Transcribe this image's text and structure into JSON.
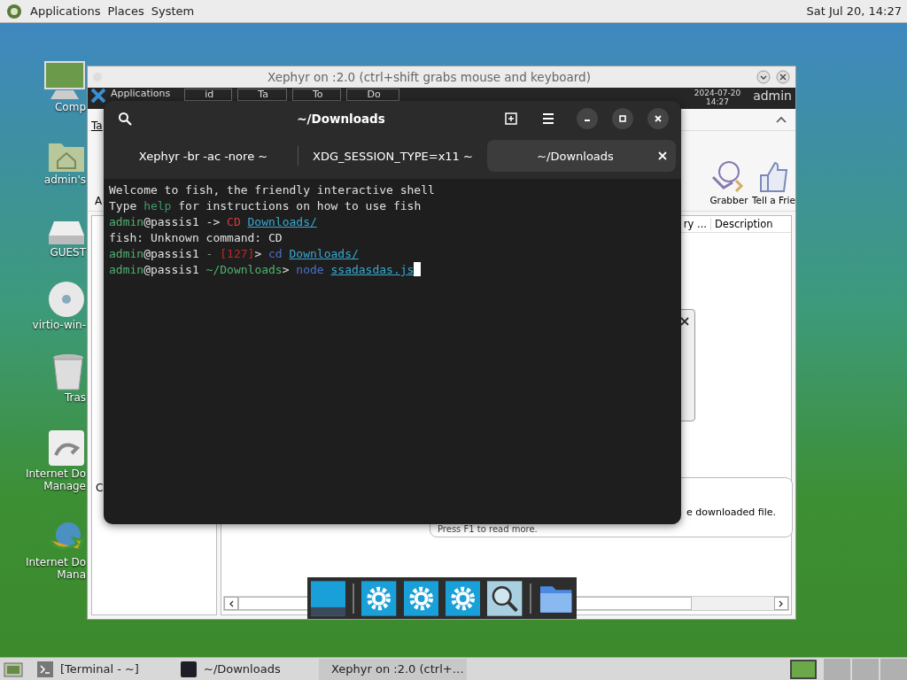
{
  "top_panel": {
    "menus": [
      "Applications",
      "Places",
      "System"
    ],
    "clock": "Sat Jul 20, 14:27"
  },
  "desktop_icons": [
    {
      "kind": "computer",
      "lines": [
        "Comp"
      ]
    },
    {
      "kind": "home",
      "lines": [
        "admin's"
      ]
    },
    {
      "kind": "drive",
      "lines": [
        "GUEST"
      ]
    },
    {
      "kind": "disc",
      "lines": [
        "virtio-win-"
      ]
    },
    {
      "kind": "trash",
      "lines": [
        "Tras"
      ]
    },
    {
      "kind": "installer",
      "lines": [
        "Internet Do",
        "Manage"
      ]
    },
    {
      "kind": "globe",
      "lines": [
        "Internet Do",
        "Mana"
      ]
    }
  ],
  "xephyr": {
    "title": "Xephyr on :2.0 (ctrl+shift grabs mouse and keyboard)",
    "panel": {
      "menu": "Applications",
      "tasks": [
        "id",
        "Ta",
        "To",
        "Do"
      ],
      "date": "2024-07-20",
      "time": "14:27",
      "user": "admin"
    },
    "app": {
      "menu_label": "Ta",
      "side_label": "A",
      "tree_label": "C",
      "toolbar": [
        "Grabber",
        "Tell a Frie"
      ],
      "columns": [
        "ry ...",
        "Description"
      ],
      "notice": [
        "e downloaded file.",
        "Press F1 to read more."
      ]
    }
  },
  "terminal": {
    "title": "~/Downloads",
    "tabs": [
      {
        "label": "Xephyr -br -ac -nore ~",
        "selected": false
      },
      {
        "label": "XDG_SESSION_TYPE=x11 ~",
        "selected": false
      },
      {
        "label": "~/Downloads",
        "selected": true
      }
    ],
    "lines": [
      [
        {
          "t": "Welcome to fish, the friendly interactive shell",
          "kind": "plain"
        }
      ],
      [
        {
          "t": "Type ",
          "kind": "plain"
        },
        {
          "t": "help",
          "kind": "keyword"
        },
        {
          "t": " for instructions on how to use fish",
          "kind": "plain"
        }
      ],
      [
        {
          "t": "admin",
          "kind": "user"
        },
        {
          "t": "@passis1 -> ",
          "kind": "plain"
        },
        {
          "t": "CD ",
          "kind": "bad_command"
        },
        {
          "t": "Downloads/",
          "kind": "path"
        }
      ],
      [
        {
          "t": "fish: Unknown command: CD",
          "kind": "plain"
        }
      ],
      [
        {
          "t": "admin",
          "kind": "user"
        },
        {
          "t": "@passis1 ",
          "kind": "plain"
        },
        {
          "t": "- ",
          "kind": "dim"
        },
        {
          "t": "[127]",
          "kind": "status"
        },
        {
          "t": "> ",
          "kind": "plain"
        },
        {
          "t": "cd ",
          "kind": "command"
        },
        {
          "t": "Downloads/",
          "kind": "path"
        }
      ],
      [
        {
          "t": "admin",
          "kind": "user"
        },
        {
          "t": "@passis1 ",
          "kind": "plain"
        },
        {
          "t": "~/Downloads",
          "kind": "cwd"
        },
        {
          "t": "> ",
          "kind": "plain"
        },
        {
          "t": "node ",
          "kind": "command"
        },
        {
          "t": "ssadasdas.js",
          "kind": "path"
        }
      ]
    ]
  },
  "taskbar": [
    {
      "label": "[Terminal - ~]",
      "kind": "terminal"
    },
    {
      "label": "~/Downloads",
      "kind": "console"
    },
    {
      "label": "Xephyr on :2.0 (ctrl+…",
      "kind": "window"
    }
  ]
}
